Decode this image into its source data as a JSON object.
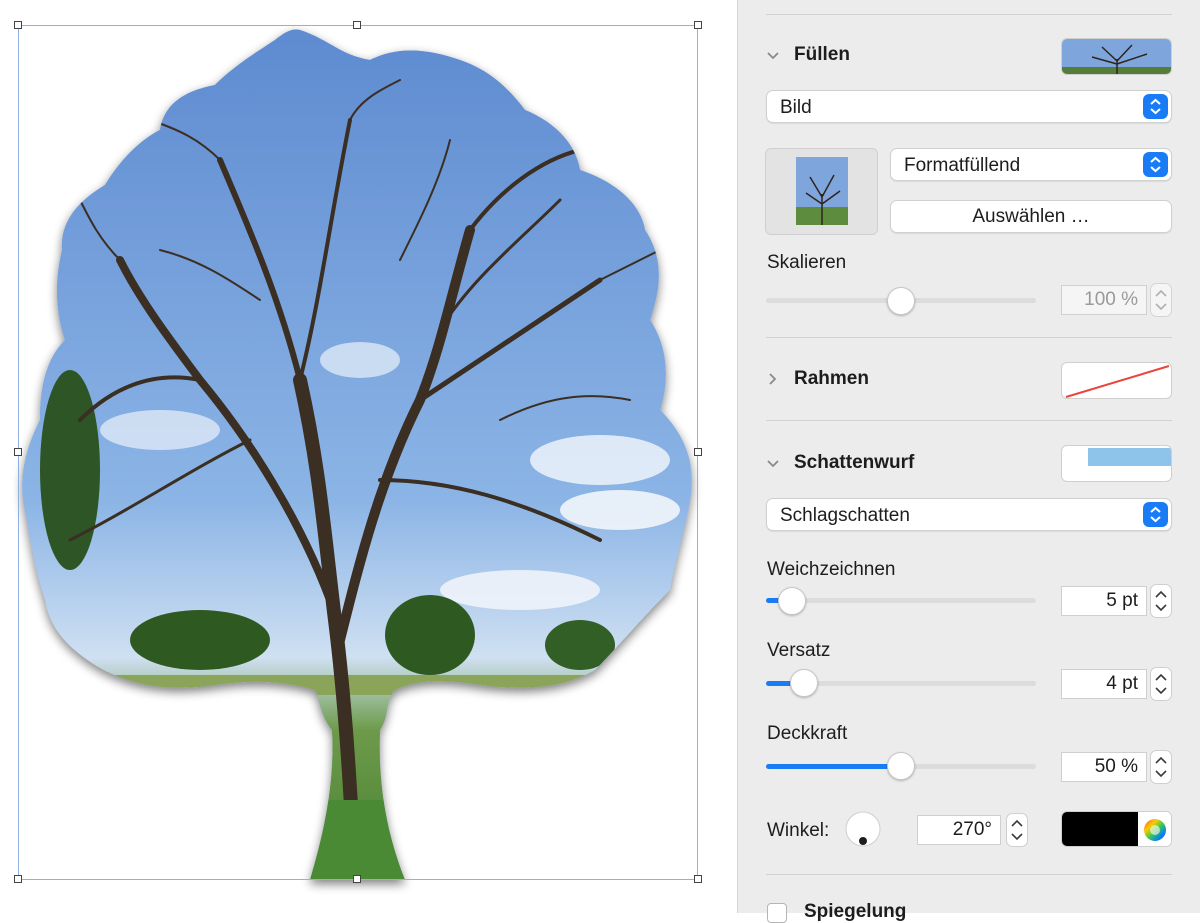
{
  "inspector": {
    "fill": {
      "title": "Füllen",
      "type_label": "Bild",
      "mode_label": "Formatfüllend",
      "choose_label": "Auswählen …"
    },
    "scale": {
      "label": "Skalieren",
      "value": "100 %",
      "level": 0.5
    },
    "border": {
      "title": "Rahmen"
    },
    "shadow": {
      "title": "Schattenwurf",
      "type_label": "Schlagschatten",
      "blur": {
        "label": "Weichzeichnen",
        "value": "5 pt",
        "level": 0.05
      },
      "offset": {
        "label": "Versatz",
        "value": "4 pt",
        "level": 0.1
      },
      "opacity": {
        "label": "Deckkraft",
        "value": "50 %",
        "level": 0.5
      },
      "angle": {
        "label": "Winkel:",
        "value": "270°"
      },
      "color": "#000000"
    },
    "mirror": {
      "label": "Spiegelung"
    }
  },
  "colors": {
    "accent": "#1a7cf5",
    "sky": "#6f9fd8",
    "selection": "#8fb0e0"
  },
  "icons": [
    "chevron-down-icon",
    "chevron-right-icon",
    "popup-arrows-icon",
    "stepper-icon",
    "color-wheel-icon"
  ]
}
